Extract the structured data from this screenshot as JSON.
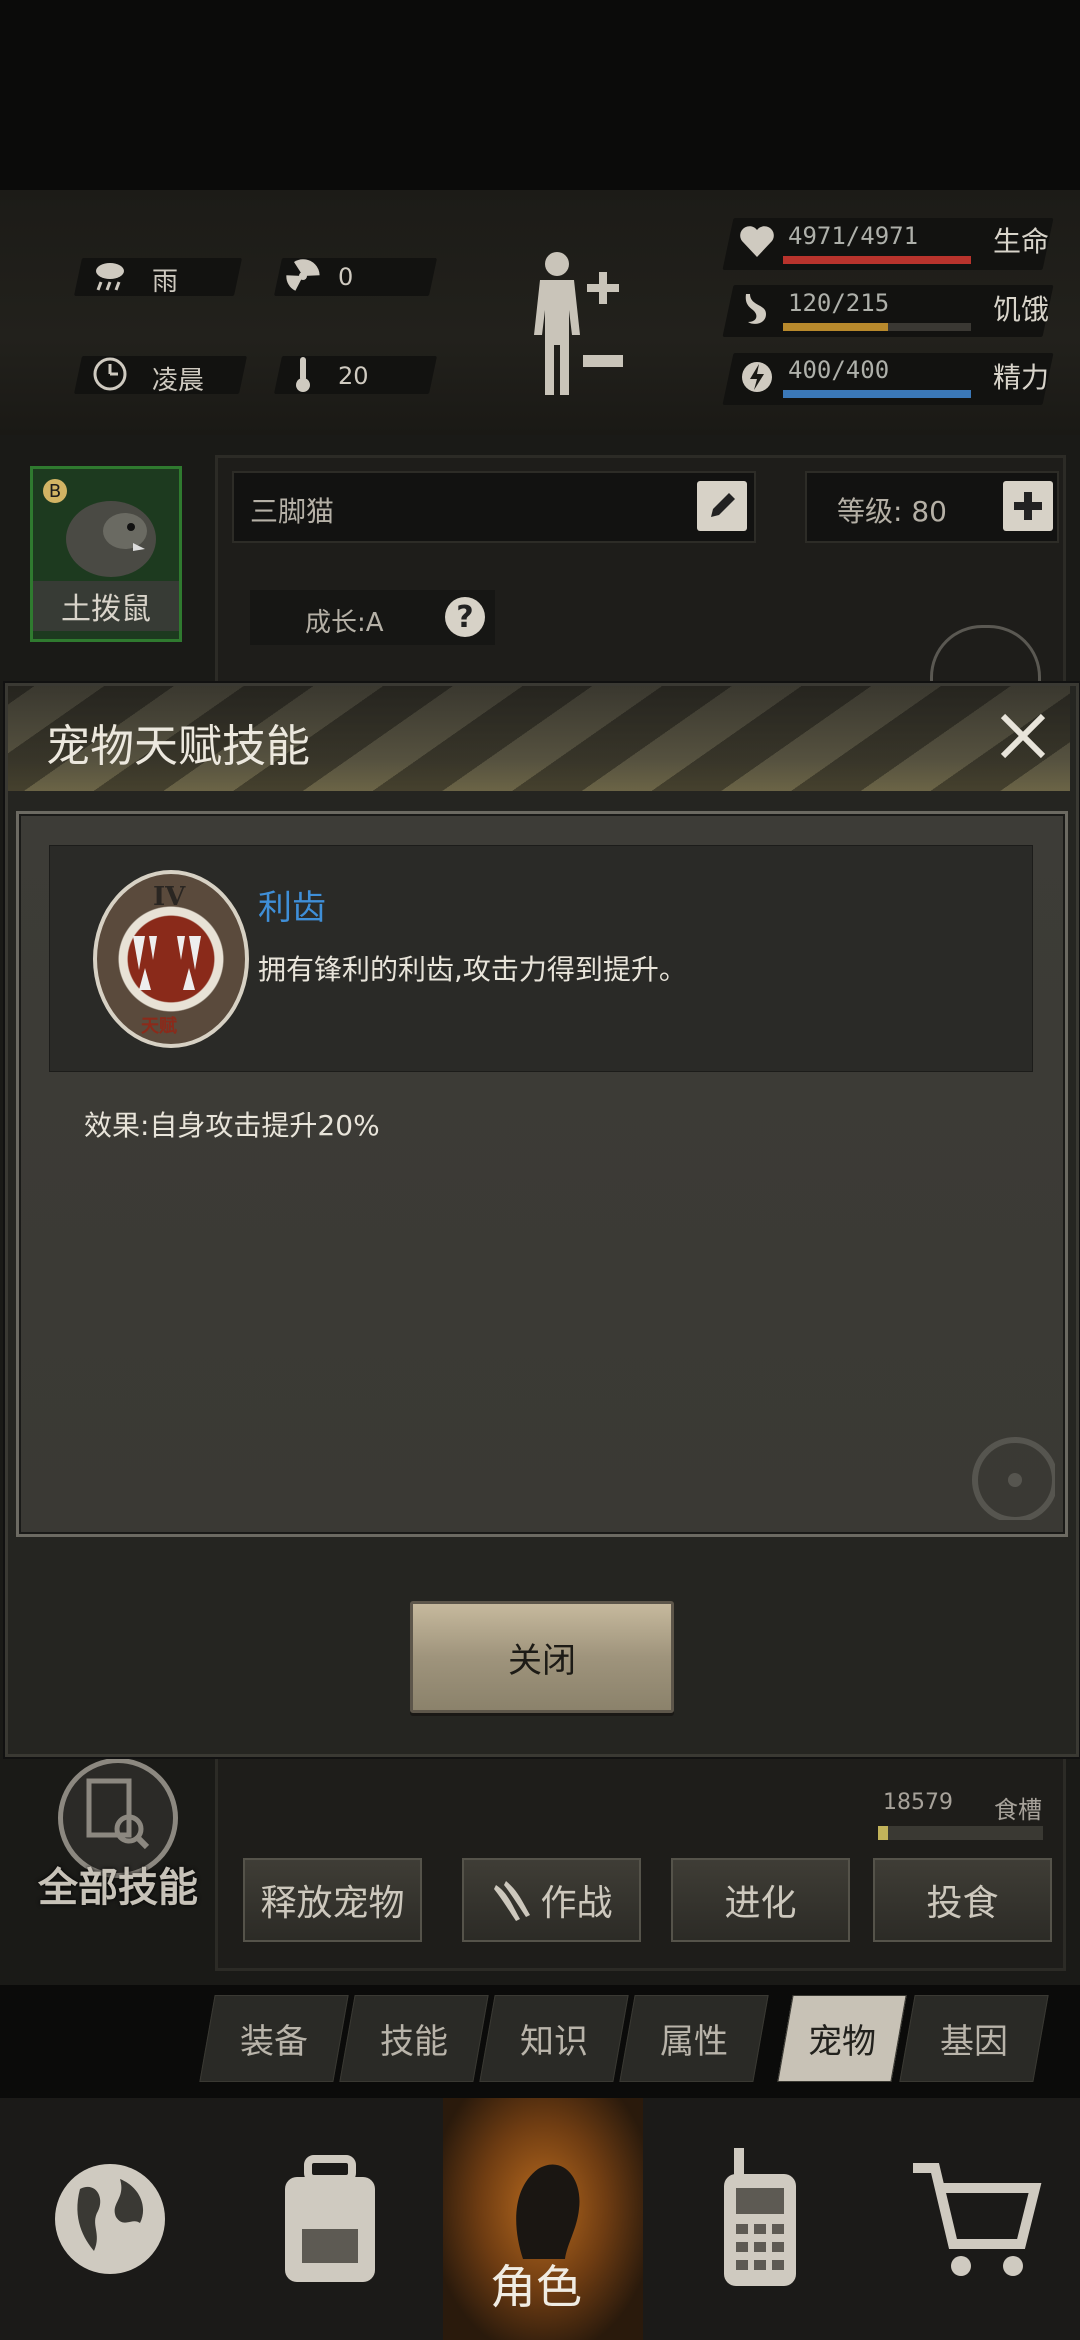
{
  "env": {
    "weather": "雨",
    "radiation": "0",
    "time_of_day": "凌晨",
    "temperature": "20"
  },
  "stats": [
    {
      "value": "4971/4971",
      "label": "生命",
      "fraction": 1.0,
      "color": "#b8332c"
    },
    {
      "value": "120/215",
      "label": "饥饿",
      "fraction": 0.56,
      "color": "#b8892c"
    },
    {
      "value": "400/400",
      "label": "精力",
      "fraction": 1.0,
      "color": "#3b78b8"
    }
  ],
  "pet": {
    "thumb_badge": "B",
    "thumb_name": "土拨鼠",
    "name": "三脚猫",
    "level_label": "等级: 80",
    "growth_label": "成长:A"
  },
  "modal": {
    "title": "宠物天赋技能",
    "skill_name": "利齿",
    "skill_desc": "拥有锋利的利齿,攻击力得到提升。",
    "skill_rank": "IV",
    "skill_tag": "天赋",
    "effect": "效果:自身攻击提升20%",
    "close_label": "关闭",
    "accent_color": "#3f8fd8"
  },
  "all_skills_label": "全部技能",
  "food": {
    "amount": "18579",
    "label": "食槽",
    "fraction": 0.06
  },
  "actions": [
    "释放宠物",
    "作战",
    "进化",
    "投食"
  ],
  "tabs": [
    {
      "label": "装备",
      "active": false
    },
    {
      "label": "技能",
      "active": false
    },
    {
      "label": "知识",
      "active": false
    },
    {
      "label": "属性",
      "active": false
    },
    {
      "label": "宠物",
      "active": true
    },
    {
      "label": "基因",
      "active": false
    }
  ],
  "nav": [
    {
      "icon": "globe-icon",
      "label": ""
    },
    {
      "icon": "backpack-icon",
      "label": ""
    },
    {
      "icon": "character-icon",
      "label": "角色",
      "active": true
    },
    {
      "icon": "radio-icon",
      "label": ""
    },
    {
      "icon": "cart-icon",
      "label": ""
    }
  ]
}
